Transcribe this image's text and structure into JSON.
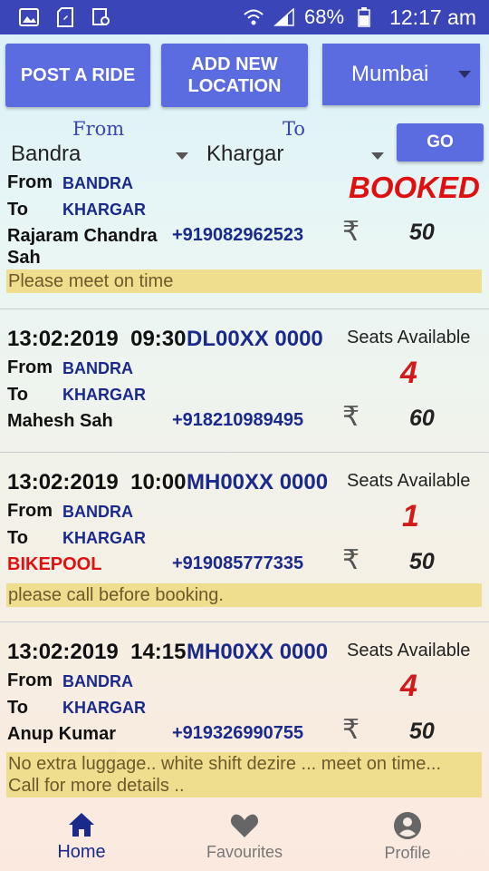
{
  "status_bar": {
    "battery": "68%",
    "time": "12:17 am"
  },
  "toolbar": {
    "post_ride": "POST A RIDE",
    "add_location_line1": "ADD NEW",
    "add_location_line2": "LOCATION",
    "city": "Mumbai"
  },
  "search": {
    "from_label": "From",
    "to_label": "To",
    "from_value": "Bandra",
    "to_value": "Khargar",
    "go": "GO"
  },
  "labels": {
    "from": "From",
    "to": "To",
    "seats_available": "Seats Available",
    "rupee": "₹"
  },
  "rides": [
    {
      "status": "BOOKED",
      "from": "BANDRA",
      "to": "KHARGAR",
      "name_line1": "Rajaram Chandra",
      "name_line2": "Sah",
      "phone": "+919082962523",
      "price": "50",
      "note": "Please meet on time"
    },
    {
      "date": "13:02:2019",
      "time": "09:30",
      "vehicle": "DL00XX 0000",
      "seats": "4",
      "from": "BANDRA",
      "to": "KHARGAR",
      "name": "Mahesh Sah",
      "phone": "+918210989495",
      "price": "60"
    },
    {
      "date": "13:02:2019",
      "time": "10:00",
      "vehicle": "MH00XX 0000",
      "seats": "1",
      "from": "BANDRA",
      "to": "KHARGAR",
      "name": "BIKEPOOL",
      "phone": "+919085777335",
      "price": "50",
      "note": "please call before booking."
    },
    {
      "date": "13:02:2019",
      "time": "14:15",
      "vehicle": "MH00XX 0000",
      "seats": "4",
      "from": "BANDRA",
      "to": "KHARGAR",
      "name": "Anup Kumar",
      "phone": "+919326990755",
      "price": "50",
      "note_line1": "No extra luggage.. white shift dezire ...  meet on time...",
      "note_line2": "Call for more details .."
    }
  ],
  "bottom_nav": {
    "home": "Home",
    "favourites": "Favourites",
    "profile": "Profile"
  },
  "colors": {
    "primary": "#5b6be0",
    "status_bar": "#3a45b8",
    "booked": "#e01010",
    "note_bg": "#f0de8f"
  }
}
